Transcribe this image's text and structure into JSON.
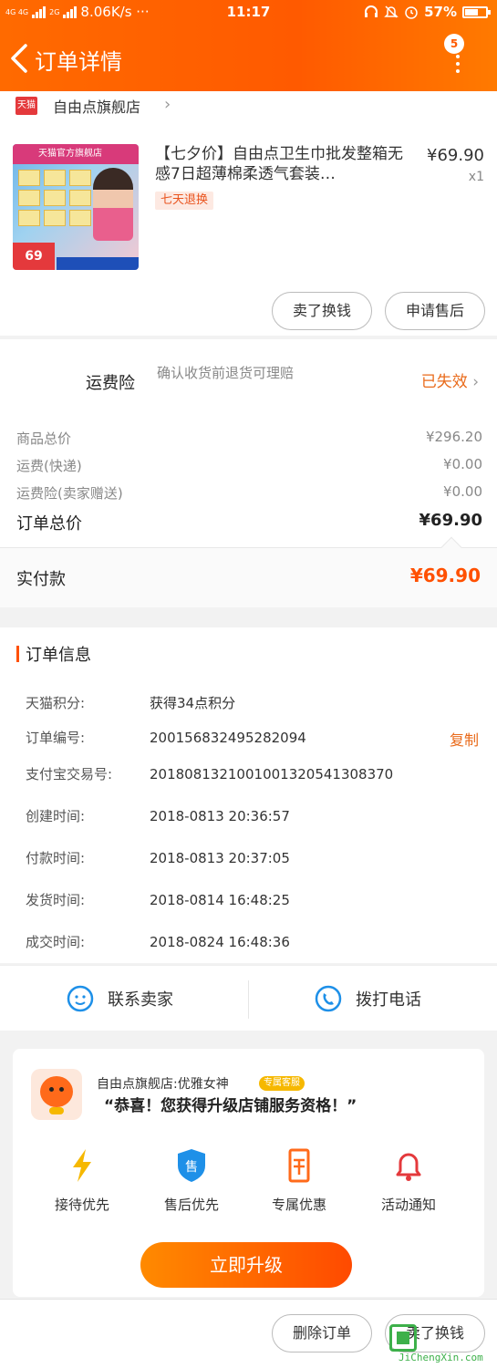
{
  "statusbar": {
    "net_top": "4G 4G",
    "net_2g": "2G",
    "speed": "8.06K/s ···",
    "time": "11:17",
    "battery": "57%"
  },
  "header": {
    "title": "订单详情",
    "badge": "5"
  },
  "shop": {
    "logo": "天猫",
    "name": "自由点旗舰店",
    "chevron": "›"
  },
  "product": {
    "image_brand": "天猫官方旗舰店",
    "image_price": "69",
    "title": "【七夕价】自由点卫生巾批发整箱无感7日超薄棉柔透气套装…",
    "tag": "七天退换",
    "price": "¥69.90",
    "qty": "x1"
  },
  "buttons": {
    "sell_label": "卖了换钱",
    "after_sale_label": "申请售后",
    "delete_label": "删除订单",
    "sell_bottom_label": "卖了换钱"
  },
  "insurance": {
    "label": "运费险",
    "desc": "确认收货前退货可理赔",
    "status": "已失效",
    "chevron": "›"
  },
  "summary": [
    {
      "label": "商品总价",
      "value": "¥296.20"
    },
    {
      "label": "运费(快递)",
      "value": "¥0.00"
    },
    {
      "label": "运费险(卖家赠送)",
      "value": "¥0.00"
    },
    {
      "label": "订单总价",
      "value": "¥69.90"
    }
  ],
  "paid": {
    "label": "实付款",
    "value": "¥69.90"
  },
  "order_info": {
    "title": "订单信息",
    "copy_label": "复制",
    "rows": [
      {
        "label": "天猫积分:",
        "value": "获得34点积分"
      },
      {
        "label": "订单编号:",
        "value": "200156832495282094"
      },
      {
        "label": "支付宝交易号:",
        "value": "2018081321001001320541308370"
      },
      {
        "label": "创建时间:",
        "value": "2018-0813 20:36:57"
      },
      {
        "label": "付款时间:",
        "value": "2018-0813 20:37:05"
      },
      {
        "label": "发货时间:",
        "value": "2018-0814 16:48:25"
      },
      {
        "label": "成交时间:",
        "value": "2018-0824 16:48:36"
      }
    ]
  },
  "contact": {
    "seller_label": "联系卖家",
    "phone_label": "拨打电话"
  },
  "upgrade": {
    "shop_line": "自由点旗舰店:优雅女神",
    "vip_badge": "专属客服",
    "message": "“恭喜！您获得升级店铺服务资格！”",
    "perks": [
      "接待优先",
      "售后优先",
      "专属优惠",
      "活动通知"
    ],
    "perk_shield_char": "售",
    "button_label": "立即升级"
  },
  "watermark": {
    "text": "JiChengXin.com"
  },
  "colors": {
    "accent": "#ff5a00",
    "orange_text": "#e96a1a",
    "tmall_red": "#e4393c"
  }
}
